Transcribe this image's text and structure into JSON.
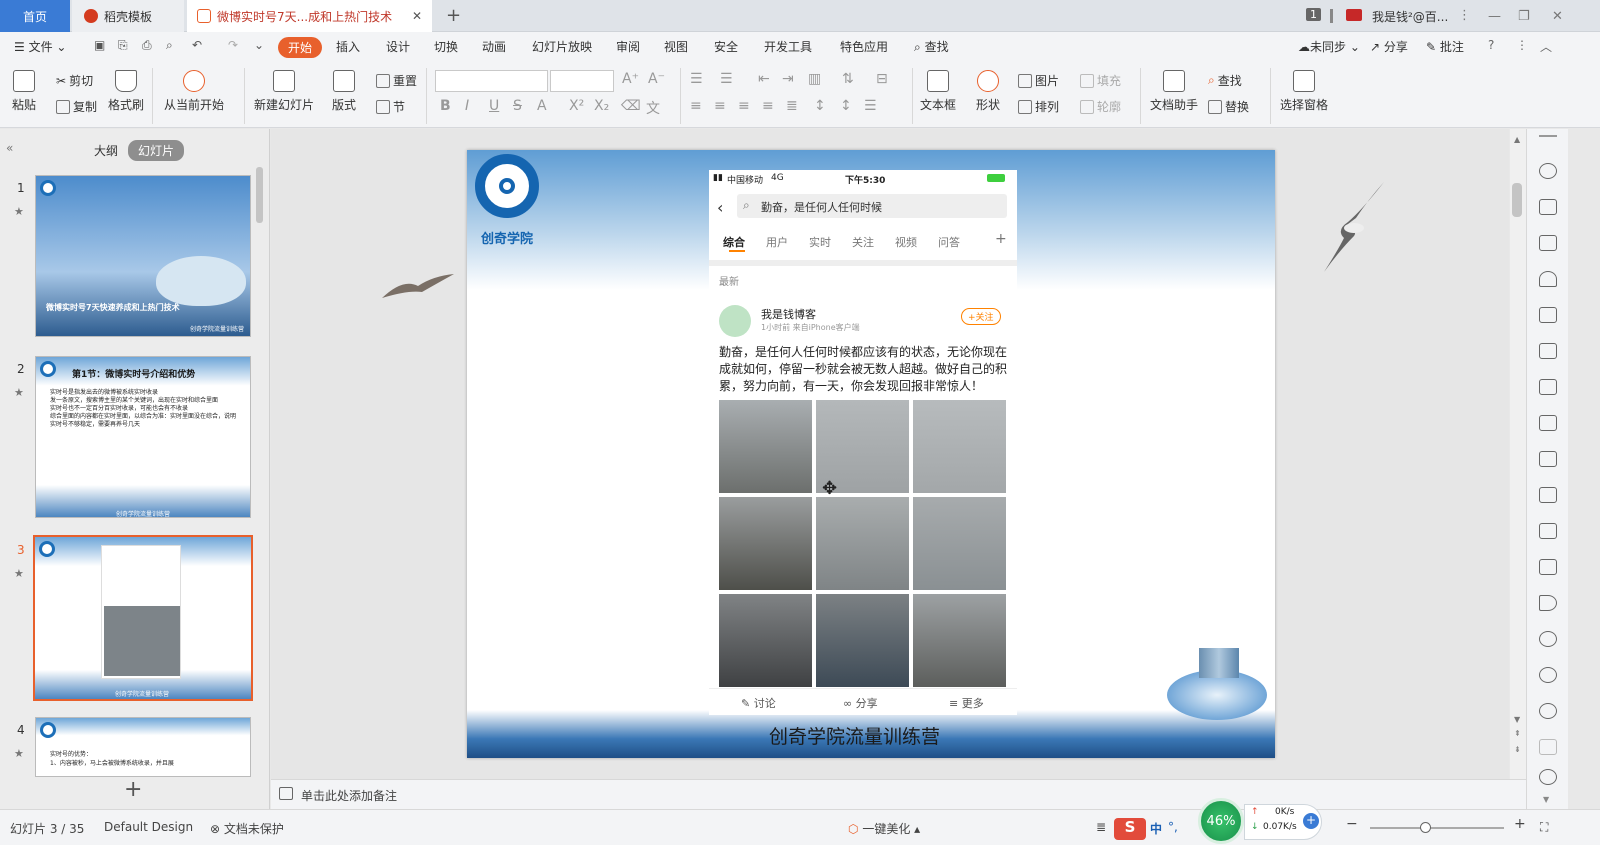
{
  "titlebar": {
    "tab_home": "首页",
    "tab_template": "稻壳模板",
    "tab_doc": "微博实时号7天...成和上热门技术",
    "window_number": "1",
    "user": "我是钱²@百..."
  },
  "menu": {
    "file": "文件",
    "items": [
      "开始",
      "插入",
      "设计",
      "切换",
      "动画",
      "幻灯片放映",
      "审阅",
      "视图",
      "安全",
      "开发工具",
      "特色应用"
    ],
    "search": "查找",
    "sync": "未同步",
    "share": "分享",
    "annotate": "批注"
  },
  "ribbon": {
    "paste": "粘贴",
    "cut": "剪切",
    "copy": "复制",
    "format_painter": "格式刷",
    "from_current": "从当前开始",
    "new_slide": "新建幻灯片",
    "layout": "版式",
    "reset": "重置",
    "section": "节",
    "textbox": "文本框",
    "shape": "形状",
    "picture": "图片",
    "fill": "填充",
    "arrange": "排列",
    "outline": "轮廓",
    "doc_helper": "文档助手",
    "find": "查找",
    "replace": "替换",
    "select_pane": "选择窗格"
  },
  "leftpanel": {
    "tab_outline": "大纲",
    "tab_slides": "幻灯片",
    "slides": [
      {
        "num": "1",
        "title": "微博实时号7天快速养成和上热门技术",
        "footer": "创奇学院流量训练营"
      },
      {
        "num": "2",
        "title": "第1节：微博实时号介绍和优势",
        "bullets": [
          "实时号是指发出去的微博被系统实时收录",
          "发一条原文，搜索博主里的某个关键词，出现在实时和综合里面",
          "实时号也不一定百分百实时收录，可能也会有不收录",
          "综合里面的内容都在实时里面，以综合为准：实时里面没在综合，说明实时号不够稳定，需要再养号几天"
        ],
        "footer": "创奇学院流量训练营"
      },
      {
        "num": "3",
        "footer": "创奇学院流量训练营"
      },
      {
        "num": "4",
        "bullets": [
          "实时号的优势：",
          "1、内容被秒，马上会被微博系统收录，并且展"
        ]
      }
    ]
  },
  "slide": {
    "logo_text": "创奇学院",
    "footer": "创奇学院流量训练营",
    "phone": {
      "carrier": "中国移动",
      "network": "4G",
      "time": "下午5:30",
      "search_text": "勤奋，是任何人任何时候",
      "tabs": [
        "综合",
        "用户",
        "实时",
        "关注",
        "视频",
        "问答"
      ],
      "filter": "最新",
      "author": "我是钱博客",
      "meta": "1小时前  来自iPhone客户端",
      "follow": "+关注",
      "post": "勤奋，是任何人任何时候都应该有的状态，无论你现在成就如何，停留一秒就会被无数人超越。做好自己的积累，努力向前，有一天，你会发现回报非常惊人！",
      "actions": [
        "讨论",
        "分享",
        "更多"
      ]
    }
  },
  "notes": {
    "placeholder": "单击此处添加备注"
  },
  "status": {
    "slide_count": "幻灯片 3 / 35",
    "theme": "Default Design",
    "protect": "文档未保护",
    "beautify": "一键美化",
    "ime": "中",
    "cpu": "46%",
    "up_speed": "0K/s",
    "down_speed": "0.07K/s"
  },
  "colors": {
    "accent": "#e8602c",
    "home_tab": "#3a7bd5",
    "weibo_orange": "#ff8200"
  }
}
